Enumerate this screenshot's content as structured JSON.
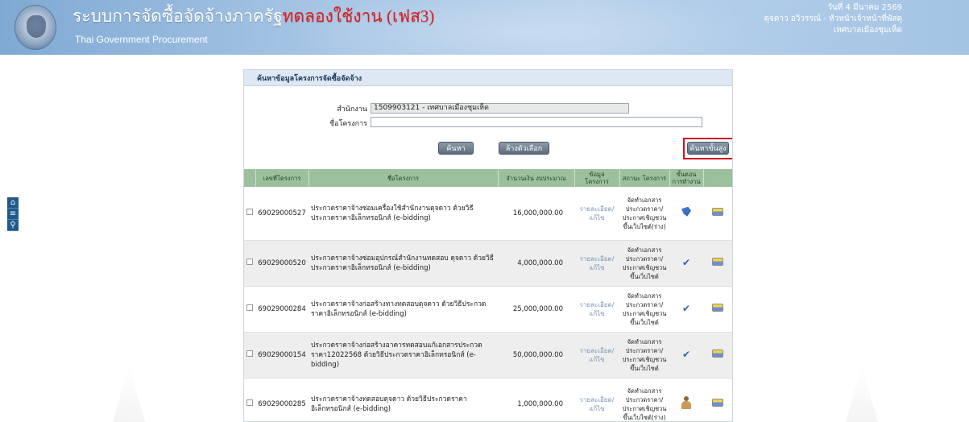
{
  "header": {
    "title_main": "ระบบการจัดซื้อจัดจ้างภาครัฐ",
    "title_suffix": "ทดลองใช้งาน (เฟส3)",
    "subtitle": "Thai Government Procurement",
    "date": "วันที่ 4 มีนาคม 2569",
    "user": "ดุจดาว อวิวรรณ์ - หัวหน้าเจ้าหน้าที่พัสดุ",
    "org": "เทศบาลเมืองชุมเห็ด"
  },
  "side_tools": [
    {
      "name": "home-icon",
      "glyph": "⌂"
    },
    {
      "name": "menu-icon",
      "glyph": "≡"
    },
    {
      "name": "search-icon",
      "glyph": "⚲"
    }
  ],
  "panel": {
    "title": "ค้นหาข้อมูลโครงการจัดซื้อจัดจ้าง",
    "office_label": "สำนักงาน",
    "office_value": "1509903121 - เทศบาลเมืองชุมเห็ด",
    "project_label": "ชื่อโครงการ",
    "project_value": "",
    "search_button": "ค้นหา",
    "clear_button": "ล้างตัวเลือก",
    "advanced_button": "ค้นหาขั้นสูง"
  },
  "table": {
    "headers": {
      "number": "เลขที่โครงการ",
      "name": "ชื่อโครงการ",
      "budget": "จำนวนเงิน งบประมาณ",
      "detail": "ข้อมูล โครงการ",
      "status": "สถานะ โครงการ",
      "step": "ขั้นตอน การทำงาน"
    },
    "rows": [
      {
        "number": "69029000527",
        "name": "ประกวดราคาจ้างซ่อมเครื่องใช้สำนักงานดุจดาว ด้วยวิธีประกวดราคาอิเล็กทรอนิกส์ (e-bidding)",
        "budget": "16,000,000.00",
        "detail": "รายละเอียด/แก้ไข",
        "status": "จัดทำเอกสารประกวดราคา/ประกาศเชิญชวนขึ้นเว็บไซต์(ร่าง)",
        "step_icon": "edit-pen-icon"
      },
      {
        "number": "69029000520",
        "name": "ประกวดราคาจ้างซ่อมอุปกรณ์สำนักงานทดสอบ ดุจดาว ด้วยวิธีประกวดราคาอิเล็กทรอนิกส์ (e-bidding)",
        "budget": "4,000,000.00",
        "detail": "รายละเอียด/แก้ไข",
        "status": "จัดทำเอกสารประกวดราคา/ประกาศเชิญชวนขึ้นเว็บไซต์",
        "step_icon": "checkmark-icon"
      },
      {
        "number": "69029000284",
        "name": "ประกวดราคาจ้างก่อสร้างทางทดสอบดุจดาว ด้วยวิธีประกวดราคาอิเล็กทรอนิกส์ (e-bidding)",
        "budget": "25,000,000.00",
        "detail": "รายละเอียด/แก้ไข",
        "status": "จัดทำเอกสารประกวดราคา/ประกาศเชิญชวนขึ้นเว็บไซต์",
        "step_icon": "checkmark-icon"
      },
      {
        "number": "69029000154",
        "name": "ประกวดราคาจ้างก่อสร้างอาคารทดสอบแก้เอกสารประกวดราคา12022568 ด้วยวิธีประกวดราคาอิเล็กทรอนิกส์ (e-bidding)",
        "budget": "50,000,000.00",
        "detail": "รายละเอียด/แก้ไข",
        "status": "จัดทำเอกสารประกวดราคา/ประกาศเชิญชวนขึ้นเว็บไซต์",
        "step_icon": "checkmark-icon"
      },
      {
        "number": "69029000285",
        "name": "ประกวดราคาจ้างทดสอบดุจดาว ด้วยวิธีประกวดราคาอิเล็กทรอนิกส์ (e-bidding)",
        "budget": "1,000,000.00",
        "detail": "รายละเอียด/แก้ไข",
        "status": "จัดทำเอกสารประกวดราคา/ประกาศเชิญชวนขึ้นเว็บไซต์(ร่าง)",
        "step_icon": "person-icon"
      }
    ]
  },
  "colors": {
    "header_blue": "#8fb3d9",
    "title_red": "#e31b1b",
    "table_header_green": "#9cc09c",
    "highlight_red": "#d0131f",
    "link_blue": "#7b94b6"
  }
}
